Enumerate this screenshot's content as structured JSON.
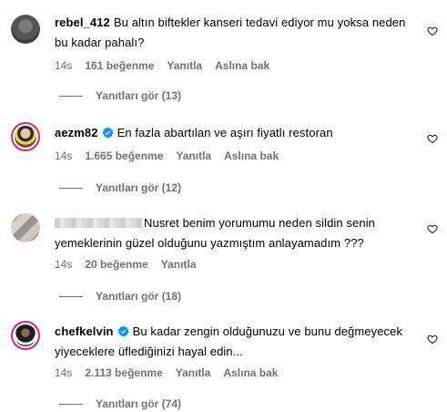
{
  "comments": [
    {
      "username": "rebel_412",
      "verified": false,
      "text": "Bu altın biftekler kanseri tedavi ediyor mu yoksa neden bu kadar pahalı?",
      "time": "14s",
      "likes": "161 beğenme",
      "reply_label": "Yanıtla",
      "translate_label": "Aslına bak",
      "view_replies": "Yanıtları gör (13)"
    },
    {
      "username": "aezm82",
      "verified": true,
      "text": "En fazla abartılan ve aşırı fiyatlı restoran",
      "time": "14s",
      "likes": "1.665 beğenme",
      "reply_label": "Yanıtla",
      "translate_label": "Aslına bak",
      "view_replies": "Yanıtları gör (12)"
    },
    {
      "username": "",
      "verified": false,
      "text": "Nusret benim yorumumu neden sildin senin yemeklerinin güzel olduğunu yazmıştım anlayamadım ???",
      "time": "14s",
      "likes": "20 beğenme",
      "reply_label": "Yanıtla",
      "view_replies": "Yanıtları gör (18)"
    },
    {
      "username": "chefkelvin",
      "verified": true,
      "text": "Bu kadar zengin olduğunuzu ve bunu değmeyecek yiyeceklere üflediğinizi hayal edin...",
      "time": "14s",
      "likes": "2.113 beğenme",
      "reply_label": "Yanıtla",
      "translate_label": "Aslına bak",
      "view_replies": "Yanıtları gör (74)"
    }
  ],
  "colors": {
    "text": "#000000",
    "muted": "#737373",
    "verified": "#0095f6",
    "story_ring": "#d62976"
  },
  "icons": {
    "like": "heart-outline-icon",
    "verified": "verified-badge-icon"
  }
}
